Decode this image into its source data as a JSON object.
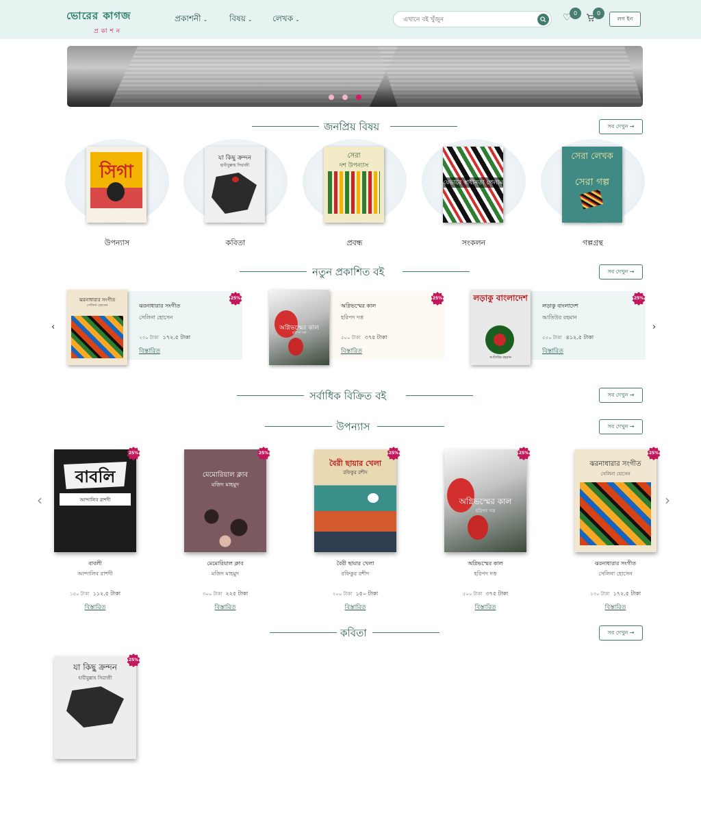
{
  "header": {
    "logo_top": "ভোরের কাগজ",
    "logo_bottom": "প্রকাশন",
    "nav": [
      {
        "label": "প্রকাশনী"
      },
      {
        "label": "বিষয়"
      },
      {
        "label": "লেখক"
      }
    ],
    "search_placeholder": "এখানে বই খুঁজুন",
    "wishlist_count": "0",
    "cart_count": "0",
    "login_label": "লগ ইন"
  },
  "banner": {
    "slides": 3,
    "active_slide": 3
  },
  "see_all_label": "সব দেখুন →",
  "sections": {
    "popular": "জনপ্রিয় বিষয়",
    "new": "নতুন প্রকাশিত বই",
    "bestseller": "সর্বাধিক বিক্রিত বই",
    "novel": "উপন্যাস",
    "poetry": "কবিতা"
  },
  "categories": [
    {
      "name": "উপন্যাস",
      "cover_title": "সিগা"
    },
    {
      "name": "কবিতা",
      "cover_title": "যা কিছু ক্রন্দন",
      "cover_sub": "হাবীবুল্লাহ সিরাজী"
    },
    {
      "name": "প্রবন্ধ",
      "cover_title": "সেরা",
      "cover_sub": "দশ উপন্যাস"
    },
    {
      "name": "সংকলন",
      "cover_title": "যেভাবে স্বাধীনতা পেলাম"
    },
    {
      "name": "গল্পগ্রন্থ",
      "cover_title": "সেরা লেখক",
      "cover_sub": "সেরা গল্প"
    }
  ],
  "discount_badge": "25%",
  "details_label": "বিস্তারিত",
  "new_books": [
    {
      "title": "ঝরনাধারার সংগীত",
      "author": "সেলিনা হোসেন",
      "old_price": "২৩০ টাকা",
      "price": "১৭২.৫ টাকা",
      "cover_title": "ঝরনাধারার সংগীত",
      "cover_author": "সেলিনা হোসেন"
    },
    {
      "title": "অগ্নিভস্মের কাল",
      "author": "হরিপদ দত্ত",
      "old_price": "৫০০ টাকা",
      "price": "৩৭৫ টাকা",
      "cover_title": "অগ্নিভস্মের কাল",
      "cover_author": "হরিপদ দত্ত"
    },
    {
      "title": "লড়াকু বাংলাদেশ",
      "author": "আতিউর রহমান",
      "old_price": "৫৫০ টাকা",
      "price": "৪১২.৫ টাকা",
      "cover_title": "লড়াকু বাংলাদেশ",
      "cover_author": "আতিউর রহমান"
    }
  ],
  "novels": [
    {
      "title": "বাবলী",
      "author": "আন্দালিব রাশদী",
      "old_price": "১৫০ টাকা",
      "price": "১১২.৫ টাকা",
      "cover_title": "বাবলি",
      "cover_author": "আন্দালিব রাশদী"
    },
    {
      "title": "মেমোরিয়াল ক্লাব",
      "author": "মজিদ মাহমুদ",
      "old_price": "৩০০ টাকা",
      "price": "২২৫ টাকা",
      "cover_title": "মেমোরিয়াল ক্লাব",
      "cover_author": "মজিদ মাহমুদ"
    },
    {
      "title": "বৈরী ছায়ার খেলা",
      "author": "রফিকুর রশীদ",
      "old_price": "২০০ টাকা",
      "price": "১৫০ টাকা",
      "cover_title": "বৈরী ছায়ার খেলা",
      "cover_author": "রফিকুর রশীদ"
    },
    {
      "title": "অগ্নিভস্মের কাল",
      "author": "হরিপদ দত্ত",
      "old_price": "৫০০ টাকা",
      "price": "৩৭৫ টাকা",
      "cover_title": "অগ্নিভস্মের কাল",
      "cover_author": "হরিপদ দত্ত"
    },
    {
      "title": "ঝরনাধারার সংগীত",
      "author": "সেলিনা হোসেন",
      "old_price": "২৩০ টাকা",
      "price": "১৭২.৫ টাকা",
      "cover_title": "ঝরনাধারার সংগীত",
      "cover_author": "সেলিনা হোসেন"
    }
  ],
  "poetry_books": [
    {
      "cover_title": "যা কিছু ক্রন্দন",
      "cover_author": "হাবীবুল্লাহ সিরাজী"
    }
  ],
  "colors": {
    "brand": "#2a7d6a",
    "accent": "#c2185b",
    "header_bg": "#e6f3f1",
    "section_line": "#3d7a6c"
  }
}
